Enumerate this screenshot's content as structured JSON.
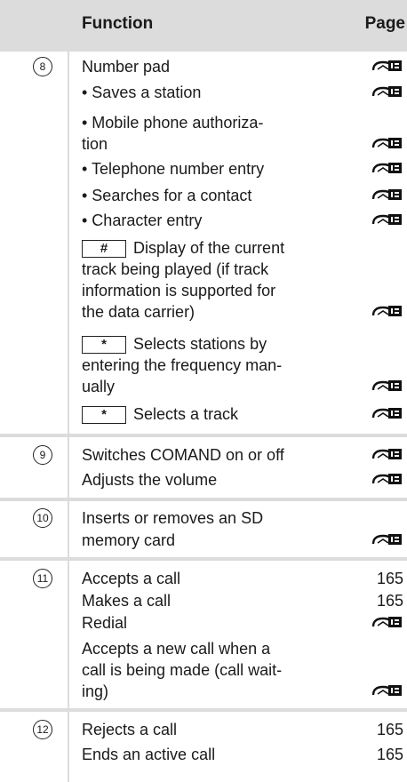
{
  "header": {
    "function": "Function",
    "page": "Page"
  },
  "rows": [
    {
      "num": "8",
      "lines": [
        "Number pad",
        "• Saves a station",
        "• Mobile phone authoriza-",
        "tion",
        "• Telephone number entry",
        "• Searches for a contact",
        "• Character entry",
        "Display of the current",
        "track being played (if track",
        "information is supported for",
        "the data carrier)",
        "Selects stations by",
        "entering the frequency man-",
        "ually",
        "Selects a track"
      ],
      "keys": [
        "#",
        "*",
        "*"
      ]
    },
    {
      "num": "9",
      "lines": [
        "Switches COMAND on or off",
        "Adjusts the volume"
      ]
    },
    {
      "num": "10",
      "lines": [
        "Inserts or removes an SD",
        "memory card"
      ]
    },
    {
      "num": "11",
      "lines": [
        "Accepts a call",
        "Makes a call",
        "Redial",
        "Accepts a new call when a",
        "call is being made (call wait-",
        "ing)"
      ],
      "pages": [
        "165",
        "165"
      ]
    },
    {
      "num": "12",
      "lines": [
        "Rejects a call",
        "Ends an active call"
      ],
      "pages": [
        "165",
        "165"
      ]
    }
  ],
  "icon": "page-ref-icon"
}
